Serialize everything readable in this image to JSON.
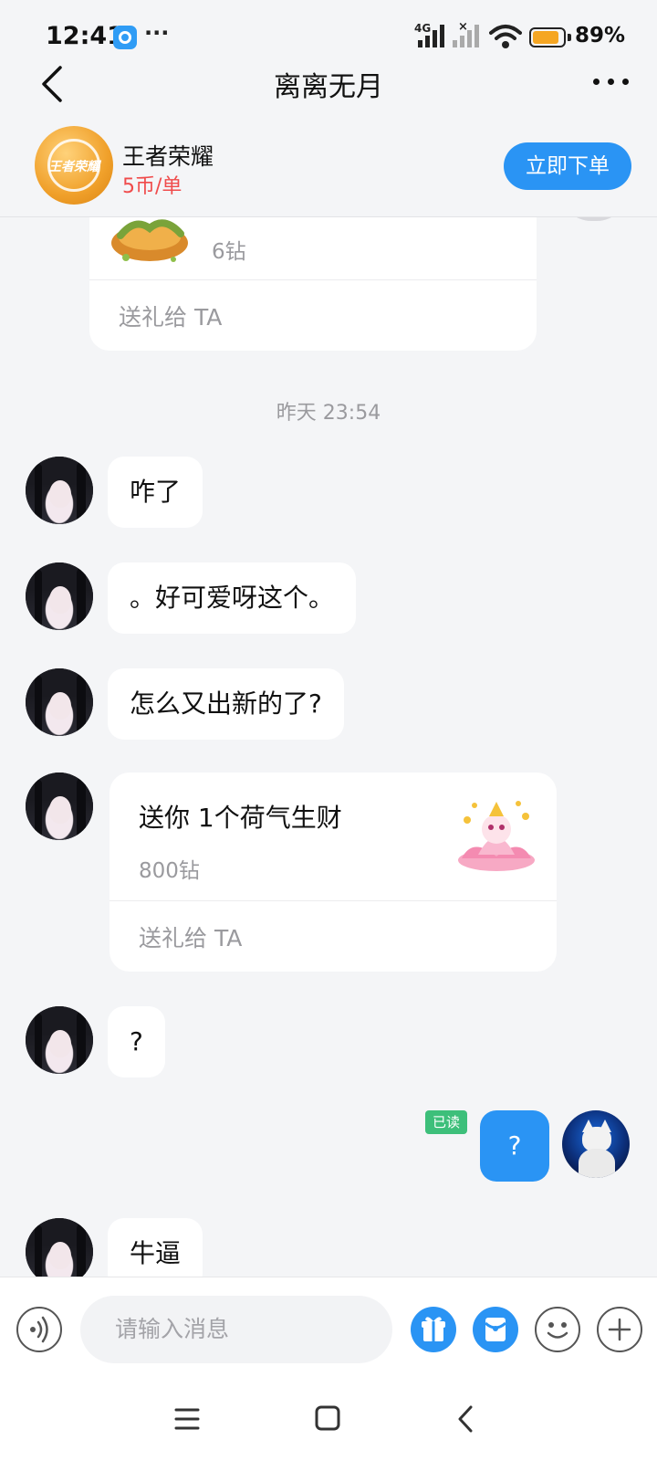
{
  "status_bar": {
    "time": "12:41",
    "more_dots": "···",
    "network_label": "4G",
    "no_signal_mark": "×",
    "battery_percent": "89%",
    "battery_level": 0.89,
    "icons": [
      "app-notification-icon",
      "signal-icon",
      "no-signal-icon",
      "wifi-icon",
      "battery-icon"
    ]
  },
  "nav": {
    "title": "离离无月",
    "back_icon": "chevron-left-icon",
    "more_icon": "more-icon"
  },
  "service": {
    "game_name": "王者荣耀",
    "logo_text": "王者荣耀",
    "price": "5币/单",
    "order_button": "立即下单"
  },
  "messages": {
    "gift_card_top": {
      "price": "6钻",
      "action": "送礼给 TA"
    },
    "timestamp": "昨天 23:54",
    "texts": [
      "咋了",
      "。好可爱呀这个。",
      "怎么又出新的了?",
      "?"
    ],
    "gift_card": {
      "title": "送你 1个荷气生财",
      "price": "800钻",
      "action": "送礼给 TA"
    },
    "my_message": {
      "text": "?",
      "read_status": "已读"
    },
    "partial_text": "牛逼"
  },
  "input": {
    "placeholder": "请输入消息",
    "icons": [
      "voice-icon",
      "gift-icon",
      "red-envelope-icon",
      "emoji-icon",
      "plus-icon"
    ]
  },
  "system_nav": {
    "icons": [
      "menu-icon",
      "home-icon",
      "back-icon"
    ]
  },
  "colors": {
    "accent": "#2a94f4",
    "price_red": "#f04b4b",
    "read_green": "#3dbf7a",
    "background": "#f4f5f7"
  }
}
